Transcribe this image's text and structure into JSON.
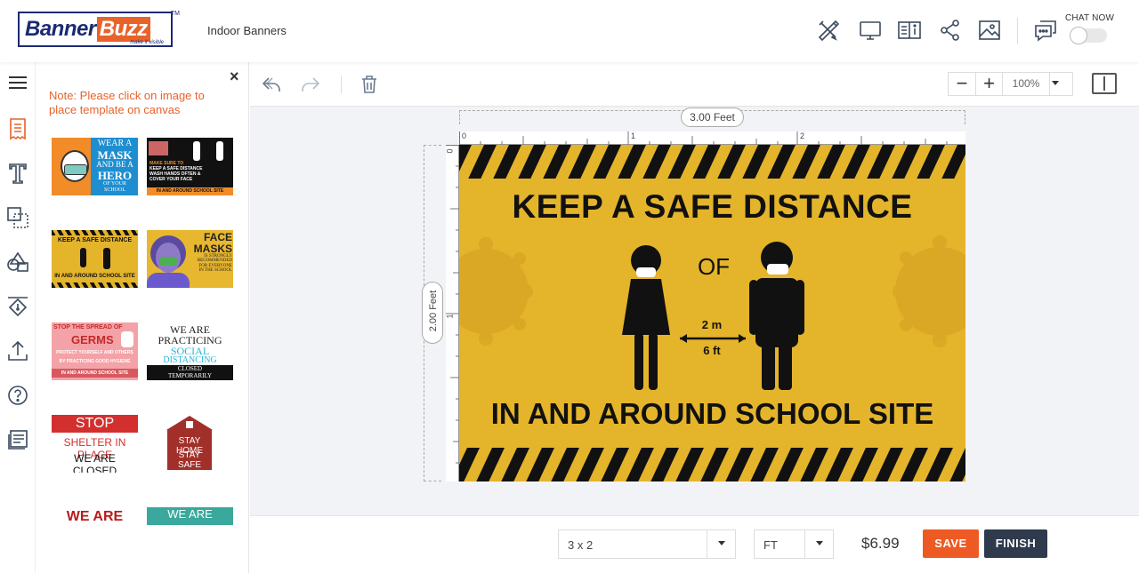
{
  "header": {
    "logo_part1": "Banner",
    "logo_part2": "Buzz",
    "logo_tagline": "make it visible",
    "logo_tm": "TM",
    "product_name": "Indoor Banners",
    "icons": [
      "tools-icon",
      "desktop-preview-icon",
      "book-info-icon",
      "share-icon",
      "image-gallery-icon",
      "chat-icon"
    ],
    "chat_label": "CHAT NOW"
  },
  "sidebar": {
    "icons": [
      "menu-icon",
      "templates-icon",
      "text-icon",
      "layers-icon",
      "shapes-icon",
      "background-fill-icon",
      "upload-icon",
      "help-icon",
      "form-icon"
    ]
  },
  "panel": {
    "close_label": "×",
    "note": "Note: Please click on image to place template on canvas",
    "templates": [
      {
        "lines": [
          "WEAR A",
          "MASK",
          "AND BE A",
          "HERO",
          "OF YOUR SCHOOL"
        ]
      },
      {
        "lines": [
          "MAKE SURE TO",
          "KEEP A SAFE DISTANCE",
          "WASH HANDS OFTEN &",
          "COVER YOUR FACE",
          "IN AND AROUND SCHOOL SITE"
        ]
      },
      {
        "lines": [
          "KEEP A SAFE DISTANCE",
          "IN AND AROUND SCHOOL SITE"
        ]
      },
      {
        "lines": [
          "FACE",
          "MASKS",
          "IS STRONGLY",
          "RECOMMENDED",
          "FOR EVERYONE",
          "IN THE SCHOOL"
        ]
      },
      {
        "lines": [
          "STOP THE SPREAD OF",
          "GERMS",
          "PROTECT YOURSELF AND OTHERS",
          "BY PRACTICING GOOD HYGIENE",
          "IN AND AROUND SCHOOL SITE"
        ]
      },
      {
        "lines": [
          "WE ARE",
          "PRACTICING",
          "SOCIAL",
          "DISTANCING",
          "CLOSED",
          "TEMPORARILY"
        ]
      },
      {
        "lines": [
          "STOP",
          "SHELTER IN PLACE",
          "WE ARE CLOSED"
        ]
      },
      {
        "lines": [
          "STAY HOME",
          "STAY SAFE"
        ]
      },
      {
        "lines": [
          "WE ARE"
        ]
      },
      {
        "lines": [
          "WE ARE"
        ]
      }
    ]
  },
  "toolbar": {
    "icons": [
      "undo-icon",
      "redo-icon",
      "trash-icon"
    ],
    "zoom_minus": "−",
    "zoom_plus": "+",
    "zoom": "100%"
  },
  "canvas": {
    "width_label": "3.00 Feet",
    "height_label": "2.00 Feet",
    "ruler_top": [
      "0",
      "1",
      "2"
    ],
    "ruler_left": [
      "0",
      "1"
    ],
    "banner": {
      "headline": "KEEP A SAFE DISTANCE",
      "of": "OF",
      "dist_m": "2 m",
      "dist_ft": "6 ft",
      "footer": "IN AND AROUND SCHOOL SITE",
      "bg_color": "#e4b42b"
    }
  },
  "bottom": {
    "size": "3 x 2",
    "unit": "FT",
    "price": "$6.99",
    "save": "SAVE",
    "finish": "FINISH"
  },
  "colors": {
    "brand_blue": "#1b2a72",
    "brand_orange": "#e8622a",
    "save": "#ed5a24",
    "finish": "#2f3a4d"
  }
}
